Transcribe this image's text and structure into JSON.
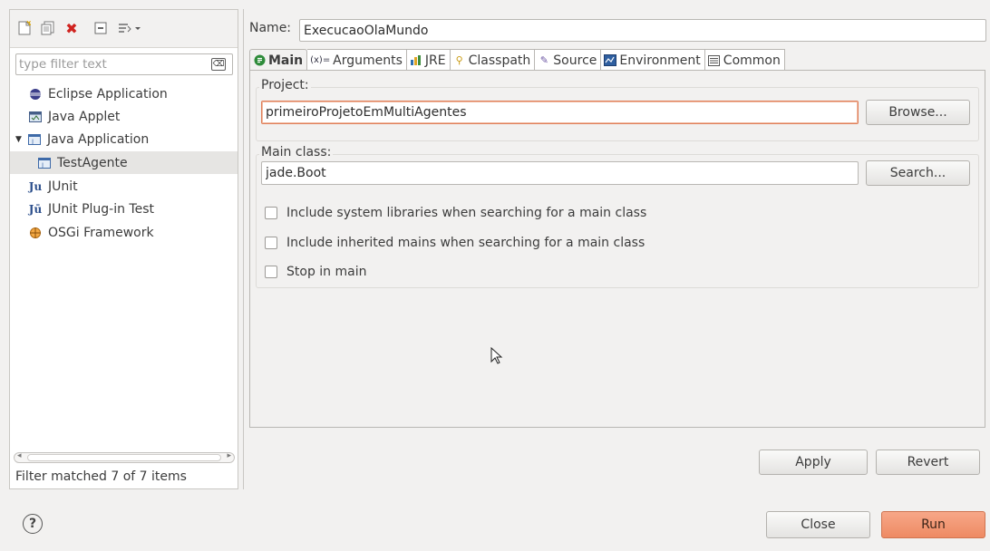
{
  "left": {
    "toolbar_icons": [
      "new-launch-config-icon",
      "duplicate-icon",
      "delete-icon",
      "collapse-all-icon",
      "filter-icon"
    ],
    "filter_placeholder": "type filter text",
    "filter_clear_glyph": "⌫",
    "tree": [
      {
        "label": "Eclipse Application",
        "icon": "eclipse-app-icon",
        "indent": 0
      },
      {
        "label": "Java Applet",
        "icon": "java-applet-icon",
        "indent": 0
      },
      {
        "label": "Java Application",
        "icon": "java-app-icon",
        "indent": 0,
        "expanded": true
      },
      {
        "label": "TestAgente",
        "icon": "java-app-icon",
        "indent": 1,
        "selected": true
      },
      {
        "label": "JUnit",
        "icon": "junit-icon",
        "indent": 0
      },
      {
        "label": "JUnit Plug-in Test",
        "icon": "junit-plugin-icon",
        "indent": 0
      },
      {
        "label": "OSGi Framework",
        "icon": "osgi-icon",
        "indent": 0
      }
    ],
    "status": "Filter matched 7 of 7 items"
  },
  "right": {
    "name_label": "Name:",
    "name_value": "ExecucaoOlaMundo",
    "tabs": [
      {
        "label": "Main",
        "icon": "main-tab-icon",
        "active": true
      },
      {
        "label": "Arguments",
        "icon": "arguments-icon"
      },
      {
        "label": "JRE",
        "icon": "jre-icon"
      },
      {
        "label": "Classpath",
        "icon": "classpath-icon"
      },
      {
        "label": "Source",
        "icon": "source-icon"
      },
      {
        "label": "Environment",
        "icon": "environment-icon"
      },
      {
        "label": "Common",
        "icon": "common-icon"
      }
    ],
    "project": {
      "label": "Project:",
      "value": "primeiroProjetoEmMultiAgentes",
      "button": "Browse..."
    },
    "main_class": {
      "label": "Main class:",
      "value": "jade.Boot",
      "button": "Search..."
    },
    "checkboxes": [
      {
        "label": "Include system libraries when searching for a main class",
        "checked": false
      },
      {
        "label": "Include inherited mains when searching for a main class",
        "checked": false
      },
      {
        "label": "Stop in main",
        "checked": false
      }
    ],
    "apply": "Apply",
    "revert": "Revert"
  },
  "footer": {
    "help_glyph": "?",
    "close": "Close",
    "run": "Run"
  },
  "colors": {
    "accent": "#ee8a63",
    "selection": "#e6e5e3"
  }
}
